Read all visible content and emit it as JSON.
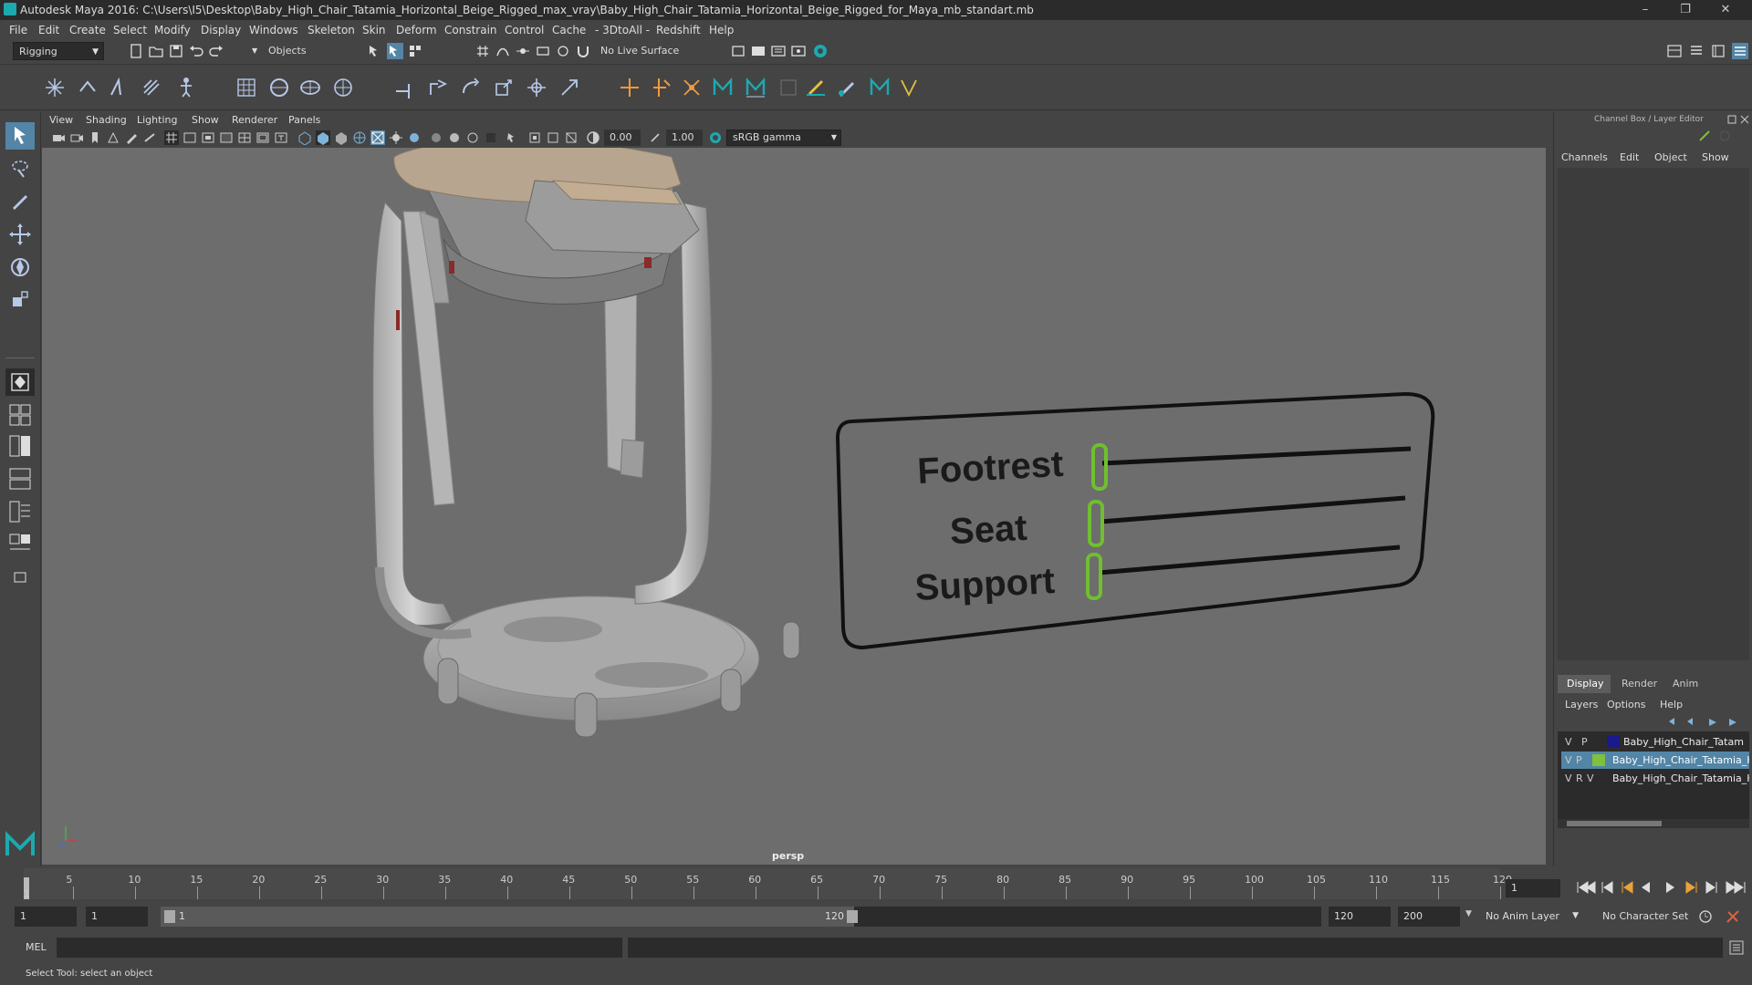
{
  "window": {
    "title": "Autodesk Maya 2016: C:\\Users\\I5\\Desktop\\Baby_High_Chair_Tatamia_Horizontal_Beige_Rigged_max_vray\\Baby_High_Chair_Tatamia_Horizontal_Beige_Rigged_for_Maya_mb_standart.mb",
    "minimize": "–",
    "maximize": "❐",
    "close": "✕"
  },
  "menubar": [
    "File",
    "Edit",
    "Create",
    "Select",
    "Modify",
    "Display",
    "Windows",
    "Skeleton",
    "Skin",
    "Deform",
    "Constrain",
    "Control",
    "Cache",
    "- 3DtoAll -",
    "Redshift",
    "Help"
  ],
  "statusline": {
    "mode": "Rigging",
    "selection_mask": "Objects",
    "live_surface": "No Live Surface"
  },
  "viewport": {
    "menu": [
      "View",
      "Shading",
      "Lighting",
      "Show",
      "Renderer",
      "Panels"
    ],
    "near_value": "0.00",
    "far_value": "1.00",
    "color_space": "sRGB gamma",
    "camera_label": "persp",
    "rig_labels": [
      "Footrest",
      "Seat",
      "Support"
    ]
  },
  "channelbox": {
    "title": "Channel Box / Layer Editor",
    "menu": [
      "Channels",
      "Edit",
      "Object",
      "Show"
    ],
    "layer_tabs": [
      "Display",
      "Render",
      "Anim"
    ],
    "layer_menu": [
      "Layers",
      "Options",
      "Help"
    ],
    "layers": [
      {
        "v": "V",
        "p": "P",
        "name": "Baby_High_Chair_Tatam",
        "color": "#1a1a8c"
      },
      {
        "v": "V",
        "p": "P",
        "name": "Baby_High_Chair_Tatamia_Ho",
        "color": "#7fc03c"
      },
      {
        "v": "V",
        "p": "R",
        "name": "Baby_High_Chair_Tatamia_Ho",
        "color": "#1e5a2a"
      }
    ]
  },
  "timeline": {
    "ticks": [
      "5",
      "10",
      "15",
      "20",
      "25",
      "30",
      "35",
      "40",
      "45",
      "50",
      "55",
      "60",
      "65",
      "70",
      "75",
      "80",
      "85",
      "90",
      "95",
      "100",
      "105",
      "110",
      "115",
      "120"
    ],
    "start_label": "1",
    "current_frame": "1",
    "range_start": "1",
    "range_inner_start": "1",
    "range_handle_start": "1",
    "range_handle_end": "120",
    "range_end": "120",
    "max_end": "200",
    "anim_layer": "No Anim Layer",
    "character_set": "No Character Set"
  },
  "cmdline": {
    "label": "MEL"
  },
  "helpline": {
    "text": "Select Tool: select an object"
  },
  "colors": {
    "accent_teal": "#1da9b0",
    "rig_green": "#6fbf2f",
    "highlight_blue": "#5285a6"
  }
}
